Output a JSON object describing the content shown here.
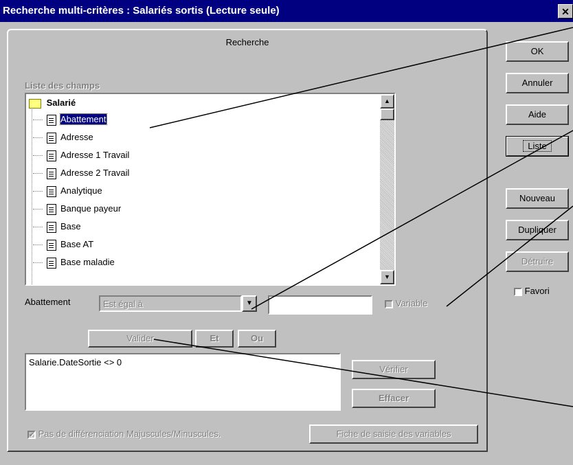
{
  "window": {
    "title": "Recherche multi-critères : Salariés sortis (Lecture seule)",
    "close_label": "✕"
  },
  "tab": {
    "label": "Recherche"
  },
  "fields": {
    "group_label": "Liste des champs",
    "folder": "Salarié",
    "items": [
      "Abattement",
      "Adresse",
      "Adresse 1 Travail",
      "Adresse 2 Travail",
      "Analytique",
      "Banque payeur",
      "Base",
      "Base AT",
      "Base maladie"
    ],
    "selected_index": 0
  },
  "criteria": {
    "field_label": "Abattement",
    "operator_value": "Est égal à",
    "value": "",
    "variable_label": "Variable"
  },
  "buttons": {
    "valider": "Valider",
    "et": "Et",
    "ou": "Ou",
    "verifier": "Vérifier",
    "effacer": "Effacer",
    "fiche": "Fiche de saisie des variables"
  },
  "query": {
    "text": "Salarie.DateSortie <> 0"
  },
  "case_option": {
    "label": "Pas de différenciation Majuscules/Minuscules."
  },
  "side": {
    "ok": "OK",
    "annuler": "Annuler",
    "aide": "Aide",
    "liste": "Liste",
    "nouveau": "Nouveau",
    "dupliquer": "Dupliquer",
    "detruire": "Détruire",
    "favori": "Favori"
  }
}
